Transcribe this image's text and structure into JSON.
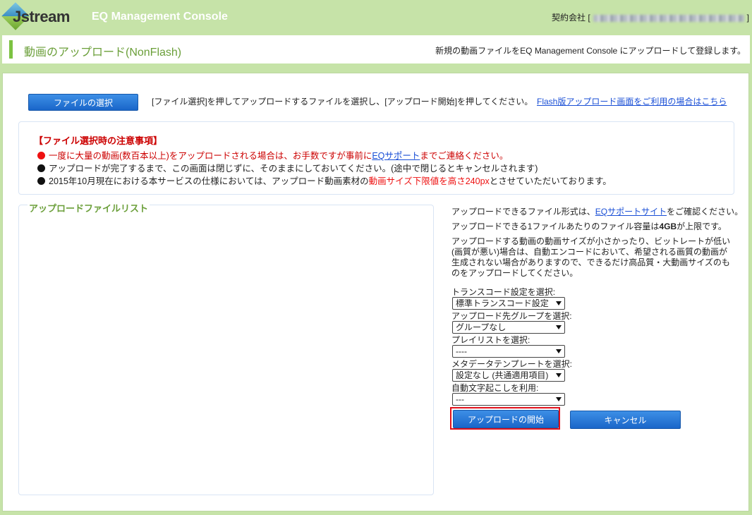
{
  "header": {
    "logo_text": "Jstream",
    "app_title": "EQ Management Console",
    "company_label": "契約会社 [",
    "company_close": "]"
  },
  "titlebar": {
    "title": "動画のアップロード(NonFlash)",
    "description": "新規の動画ファイルをEQ Management Console にアップロードして登録します。"
  },
  "toolbar": {
    "select_file_label": "ファイルの選択",
    "instruction": "[ファイル選択]を押してアップロードするファイルを選択し、[アップロード開始]を押してください。",
    "flash_link": "Flash版アップロード画面をご利用の場合はこちら"
  },
  "notice": {
    "heading": "【ファイル選択時の注意事項】",
    "line1_pre": "一度に大量の動画(数百本以上)をアップロードされる場合は、お手数ですが事前に",
    "line1_link": "EQサポート",
    "line1_post": "までご連絡ください。",
    "line2": "アップロードが完了するまで、この画面は閉じずに、そのままにしておいてください。(途中で閉じるとキャンセルされます)",
    "line3_pre": "2015年10月現在における本サービスの仕様においては、アップロード動画素材の",
    "line3_red": "動画サイズ下限値を高さ240px",
    "line3_post": "とさせていただいております。"
  },
  "filelist": {
    "legend": "アップロードファイルリスト"
  },
  "side": {
    "p1_pre": "アップロードできるファイル形式は、",
    "p1_link": "EQサポートサイト",
    "p1_post": "をご確認ください。",
    "p2_pre": "アップロードできる1ファイルあたりのファイル容量は",
    "p2_bold": "4GB",
    "p2_post": "が上限です。",
    "p3": "アップロードする動画の動画サイズが小さかったり、ビットレートが低い(画質が悪い)場合は、自動エンコードにおいて、希望される画質の動画が生成されない場合がありますので、できるだけ高品質・大動画サイズのものをアップロードしてください。",
    "transcode_label": "トランスコード設定を選択:",
    "transcode_value": "標準トランスコード設定",
    "group_label": "アップロード先グループを選択:",
    "group_value": "グループなし",
    "playlist_label": "プレイリストを選択:",
    "playlist_value": "----",
    "metadata_label": "メタデータテンプレートを選択:",
    "metadata_value": "設定なし (共通適用項目)",
    "caption_label": "自動文字起こしを利用:",
    "caption_value": "---",
    "upload_label": "アップロードの開始",
    "cancel_label": "キャンセル"
  },
  "colors": {
    "header_bg": "#c6e3a8",
    "accent_green": "#7cc242",
    "button_blue": "#1a66c9",
    "alert_red": "#ee1111",
    "highlight_border": "#e0101a"
  }
}
